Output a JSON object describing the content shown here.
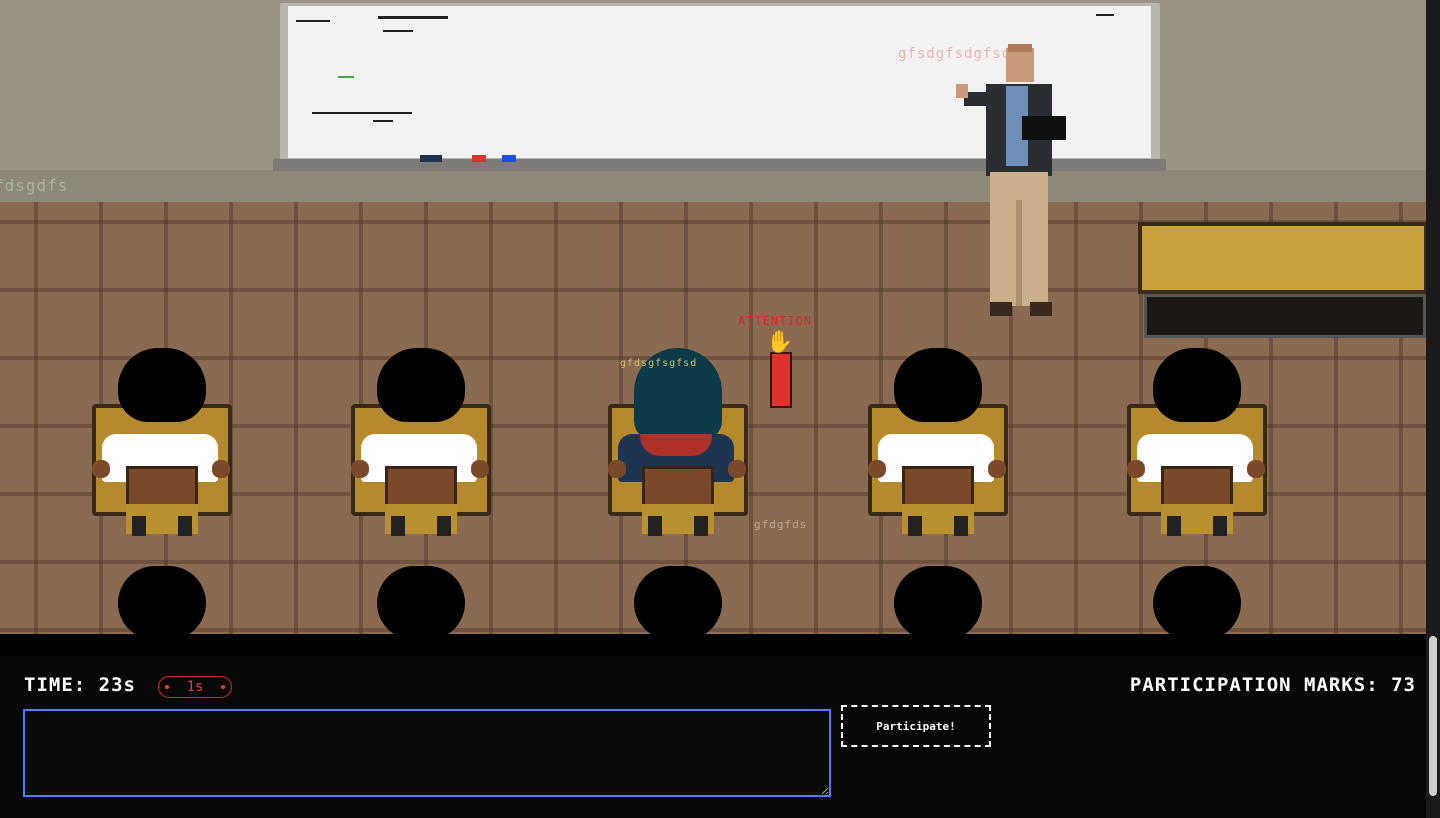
{
  "scene": {
    "attention_label": "ATTENTION",
    "floating_names": {
      "board": "gfsdgfsdgfsd",
      "left_wall": "fdsgdfs",
      "above_player": "gfdsgfsgfsd",
      "near_desk": "gfdgfds"
    },
    "colors": {
      "attention": "#d8262a",
      "board": "#f2f2f0",
      "floor": "#8b6a52"
    },
    "icons": {
      "raised_hand": "raised-hand-icon"
    }
  },
  "hud": {
    "time_label": "TIME:",
    "time_value": "23s",
    "penalty_value": "1s",
    "marks_label": "PARTICIPATION MARKS:",
    "marks_value": "73",
    "answer_value": "",
    "participate_label": "Participate!"
  }
}
